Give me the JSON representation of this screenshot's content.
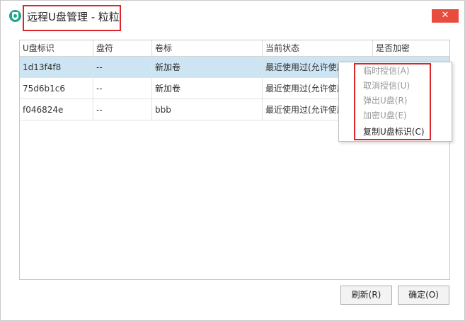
{
  "window": {
    "title": "远程U盘管理 - 粒粒",
    "close_label": "✕"
  },
  "table": {
    "columns": [
      "U盘标识",
      "盘符",
      "卷标",
      "当前状态",
      "是否加密"
    ],
    "rows": [
      [
        "1d13f4f8",
        "--",
        "新加卷",
        "最近使用过(允许使用)",
        ""
      ],
      [
        "75d6b1c6",
        "--",
        "新加卷",
        "最近使用过(允许使用)",
        ""
      ],
      [
        "f046824e",
        "--",
        "bbb",
        "最近使用过(允许使用)",
        ""
      ]
    ],
    "selected_row": 0
  },
  "context_menu": {
    "items": [
      {
        "label": "临时授信(A)",
        "enabled": false
      },
      {
        "label": "取消授信(U)",
        "enabled": false
      },
      {
        "label": "弹出U盘(R)",
        "enabled": false
      },
      {
        "label": "加密U盘(E)",
        "enabled": false
      },
      {
        "label": "复制U盘标识(C)",
        "enabled": true
      }
    ]
  },
  "buttons": {
    "refresh_label": "刷新(R)",
    "ok_label": "确定(O)"
  },
  "colors": {
    "accent_red": "#d9262b",
    "close_button": "#e84c3d",
    "selected_row": "#cde4f3",
    "app_icon": "#1ea58a"
  }
}
